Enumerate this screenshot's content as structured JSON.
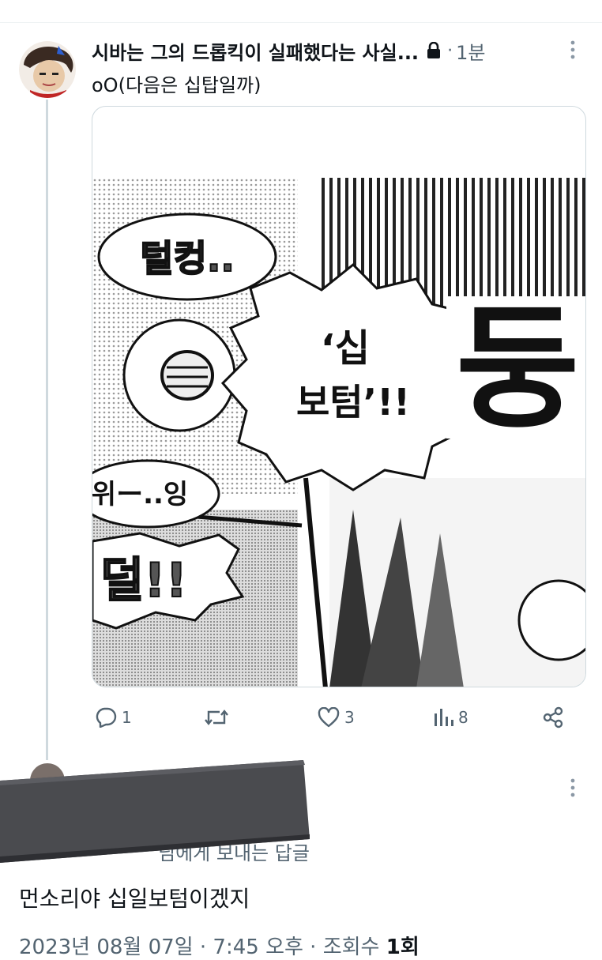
{
  "tweet": {
    "display_name": "시바는 그의 드롭킥이 실패했다는 사실...",
    "meta_separator": "·",
    "time": "1분",
    "text": "oO(다음은 십탑일까)",
    "media": {
      "panel_sfx_top_left": "털컹..",
      "panel_center_line1": "‘십",
      "panel_center_line2": "보텀’!!",
      "panel_sfx_right": "둥",
      "panel_sfx_left_mid": "위ー..잉",
      "panel_sfx_left_bottom": "덜!!"
    },
    "actions": {
      "replies": "1",
      "retweets": "",
      "likes": "3",
      "views": "8"
    }
  },
  "reply": {
    "replying_to": "님에게 보내는 답글",
    "text": "먼소리야 십일보텀이겠지",
    "timestamp_text": "2023년 08월 07일 · 7:45 오후 · 조회수 ",
    "view_count": "1회"
  },
  "icons": {
    "lock": "lock-icon",
    "more": "more-vertical-icon",
    "reply": "reply-icon",
    "retweet": "retweet-icon",
    "like": "heart-icon",
    "views": "views-icon",
    "share": "share-icon"
  }
}
